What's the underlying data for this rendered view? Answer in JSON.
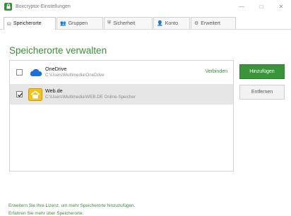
{
  "window": {
    "title": "Boxcryptor-Einstellungen",
    "controls": {
      "minimize": "—",
      "maximize": "□",
      "close": "✕"
    }
  },
  "tabs": [
    {
      "icon": "storage-icon",
      "glyph": "⛁",
      "label": "Speicherorte",
      "active": true
    },
    {
      "icon": "groups-icon",
      "glyph": "👥",
      "label": "Gruppen",
      "active": false
    },
    {
      "icon": "shield-icon",
      "glyph": "⛨",
      "label": "Sicherheit",
      "active": false
    },
    {
      "icon": "account-icon",
      "glyph": "👤",
      "label": "Konto",
      "active": false
    },
    {
      "icon": "gear-icon",
      "glyph": "⚙",
      "label": "Erweitert",
      "active": false
    }
  ],
  "main": {
    "heading": "Speicherorte verwalten",
    "locations": [
      {
        "name": "OneDrive",
        "path": "C:\\Users\\Multimedia\\OneDrive",
        "checked": false,
        "icon": "onedrive-cloud-icon",
        "action_label": "Verbinden"
      },
      {
        "name": "Web.de",
        "path": "C:\\Users\\Multimedia\\WEB.DE Online-Speicher",
        "checked": true,
        "icon": "webde-icon",
        "selected": true
      }
    ],
    "buttons": {
      "add": "Hinzufügen",
      "remove": "Entfernen"
    }
  },
  "footer": {
    "line1": "Erweitern Sie Ihre Lizenz, um mehr Speicherorte hinzuzufügen.",
    "line2": "Erfahren Sie mehr über Speicherorte."
  },
  "colors": {
    "accent_green": "#3a943a",
    "onedrive_blue": "#1e6fd9",
    "webde_yellow": "#f3c318",
    "selected_row": "#e6e6e6"
  }
}
